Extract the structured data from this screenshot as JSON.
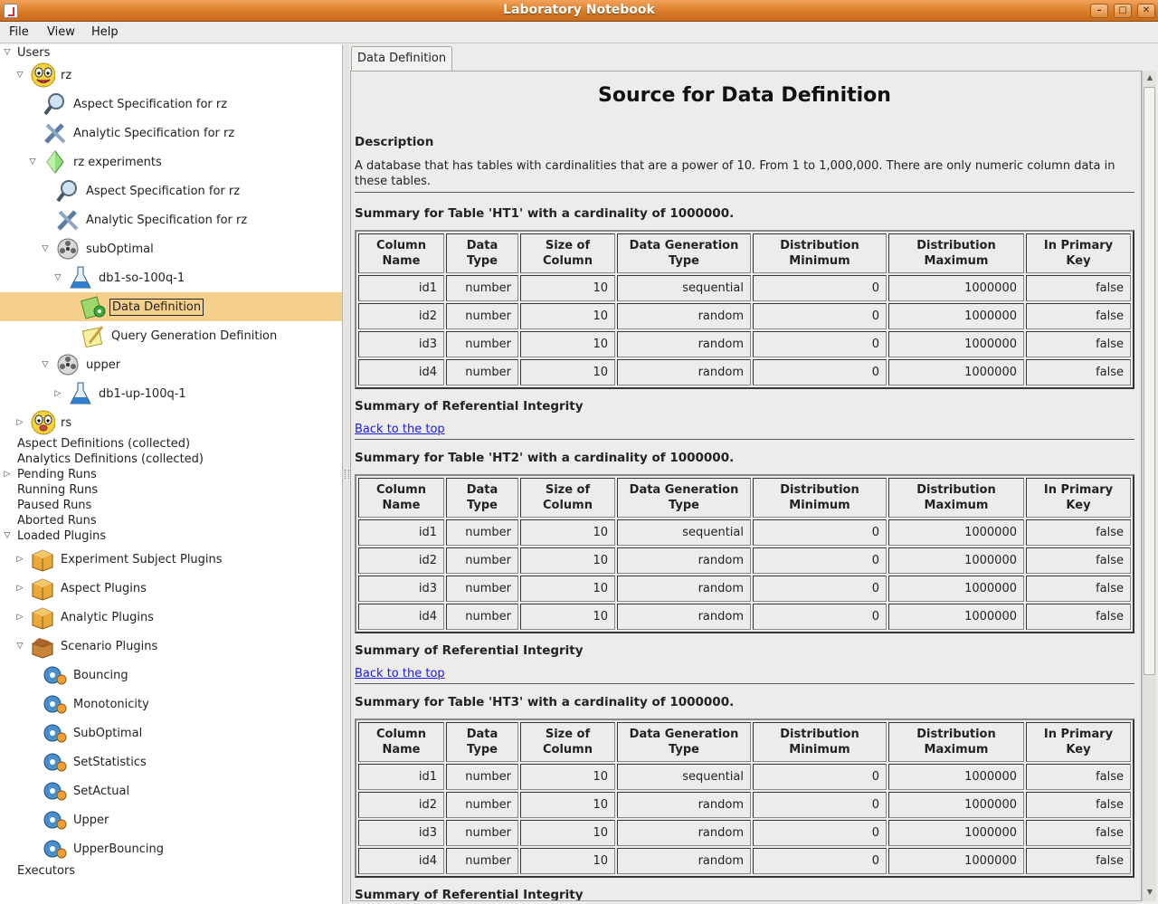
{
  "window": {
    "title": "Laboratory Notebook"
  },
  "menu": [
    "File",
    "View",
    "Help"
  ],
  "tree": {
    "users": "Users",
    "rz": "rz",
    "aspect_spec_rz": "Aspect Specification for rz",
    "analytic_spec_rz": "Analytic Specification for rz",
    "rz_experiments": "rz experiments",
    "aspect_spec_rz_2": "Aspect Specification for rz",
    "analytic_spec_rz_2": "Analytic Specification for rz",
    "suboptimal": "subOptimal",
    "db1_so": "db1-so-100q-1",
    "data_definition": "Data Definition",
    "query_gen": "Query Generation Definition",
    "upper": "upper",
    "db1_up": "db1-up-100q-1",
    "rs": "rs",
    "aspect_defs": "Aspect Definitions (collected)",
    "analytics_defs": "Analytics Definitions (collected)",
    "pending_runs": "Pending Runs",
    "running_runs": "Running Runs",
    "paused_runs": "Paused Runs",
    "aborted_runs": "Aborted Runs",
    "loaded_plugins": "Loaded Plugins",
    "experiment_subject_plugins": "Experiment Subject Plugins",
    "aspect_plugins": "Aspect Plugins",
    "analytic_plugins": "Analytic Plugins",
    "scenario_plugins": "Scenario Plugins",
    "scenarios": [
      "Bouncing",
      "Monotonicity",
      "SubOptimal",
      "SetStatistics",
      "SetActual",
      "Upper",
      "UpperBouncing"
    ],
    "executors": "Executors"
  },
  "tab": {
    "label": "Data Definition"
  },
  "doc": {
    "title": "Source for Data Definition",
    "description_heading": "Description",
    "description": "A database that has tables with cardinalities that are a power of 10. From 1 to 1,000,000. There are only numeric column data in these tables.",
    "columns": [
      "Column Name",
      "Data Type",
      "Size of Column",
      "Data Generation Type",
      "Distribution Minimum",
      "Distribution Maximum",
      "In Primary Key"
    ],
    "ref_heading": "Summary of Referential Integrity",
    "back_link": "Back to the top",
    "tables": [
      {
        "heading": "Summary for Table 'HT1' with a cardinality of 1000000.",
        "rows": [
          [
            "id1",
            "number",
            "10",
            "sequential",
            "0",
            "1000000",
            "false"
          ],
          [
            "id2",
            "number",
            "10",
            "random",
            "0",
            "1000000",
            "false"
          ],
          [
            "id3",
            "number",
            "10",
            "random",
            "0",
            "1000000",
            "false"
          ],
          [
            "id4",
            "number",
            "10",
            "random",
            "0",
            "1000000",
            "false"
          ]
        ]
      },
      {
        "heading": "Summary for Table 'HT2' with a cardinality of 1000000.",
        "rows": [
          [
            "id1",
            "number",
            "10",
            "sequential",
            "0",
            "1000000",
            "false"
          ],
          [
            "id2",
            "number",
            "10",
            "random",
            "0",
            "1000000",
            "false"
          ],
          [
            "id3",
            "number",
            "10",
            "random",
            "0",
            "1000000",
            "false"
          ],
          [
            "id4",
            "number",
            "10",
            "random",
            "0",
            "1000000",
            "false"
          ]
        ]
      },
      {
        "heading": "Summary for Table 'HT3' with a cardinality of 1000000.",
        "rows": [
          [
            "id1",
            "number",
            "10",
            "sequential",
            "0",
            "1000000",
            "false"
          ],
          [
            "id2",
            "number",
            "10",
            "random",
            "0",
            "1000000",
            "false"
          ],
          [
            "id3",
            "number",
            "10",
            "random",
            "0",
            "1000000",
            "false"
          ],
          [
            "id4",
            "number",
            "10",
            "random",
            "0",
            "1000000",
            "false"
          ]
        ]
      }
    ]
  },
  "colors": {
    "titlebar": "#d97b28",
    "selection": "#f5d08c",
    "link": "#1a1aee"
  }
}
